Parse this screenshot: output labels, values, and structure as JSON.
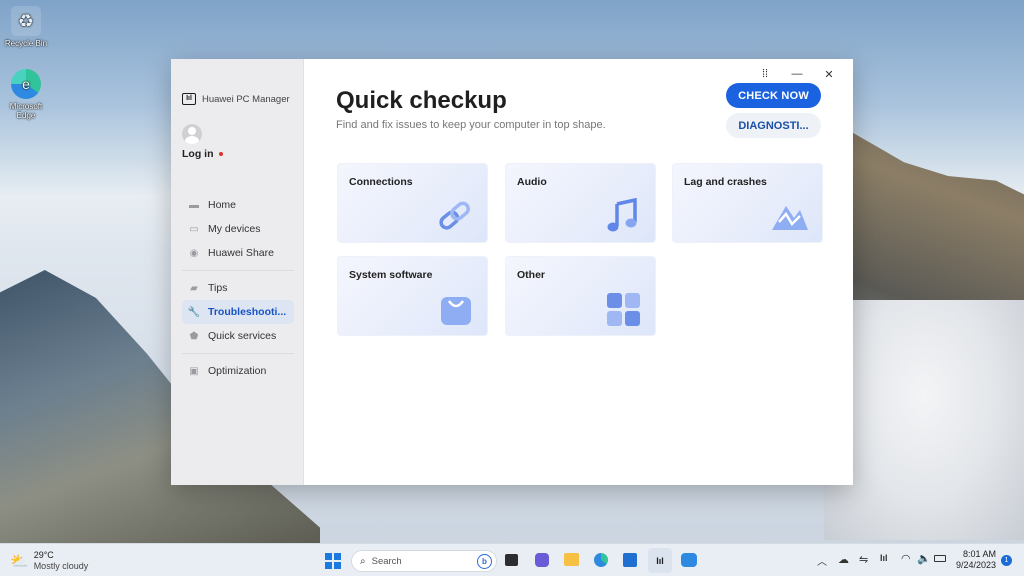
{
  "desktop": {
    "icons": [
      {
        "label": "Recycle Bin",
        "icon": "recycle-bin-icon"
      },
      {
        "label": "Microsoft Edge",
        "icon": "edge-icon"
      }
    ]
  },
  "app": {
    "brand": "Huawei PC Manager",
    "login": "Log in",
    "nav": [
      {
        "label": "Home",
        "icon": "home-icon"
      },
      {
        "label": "My devices",
        "icon": "devices-icon"
      },
      {
        "label": "Huawei Share",
        "icon": "share-icon"
      },
      {
        "label": "Tips",
        "icon": "tips-icon"
      },
      {
        "label": "Troubleshooti...",
        "icon": "wrench-icon",
        "active": true
      },
      {
        "label": "Quick services",
        "icon": "shield-icon"
      },
      {
        "label": "Optimization",
        "icon": "optimization-icon"
      }
    ],
    "title": "Quick checkup",
    "subtitle": "Find and fix issues to keep your computer in top shape.",
    "check_now": "CHECK NOW",
    "diagnostics": "DIAGNOSTI...",
    "cards": [
      {
        "label": "Connections",
        "icon": "link-icon"
      },
      {
        "label": "Audio",
        "icon": "music-note-icon"
      },
      {
        "label": "Lag and crashes",
        "icon": "mountain-chart-icon"
      },
      {
        "label": "System software",
        "icon": "bag-icon"
      },
      {
        "label": "Other",
        "icon": "grid-icon"
      }
    ],
    "colors": {
      "accent": "#1b62e0",
      "active_nav": "#1653c4"
    }
  },
  "taskbar": {
    "weather": {
      "temp": "29°C",
      "desc": "Mostly cloudy"
    },
    "search_placeholder": "Search",
    "time": "8:01 AM",
    "date": "9/24/2023",
    "notification_count": "1"
  }
}
